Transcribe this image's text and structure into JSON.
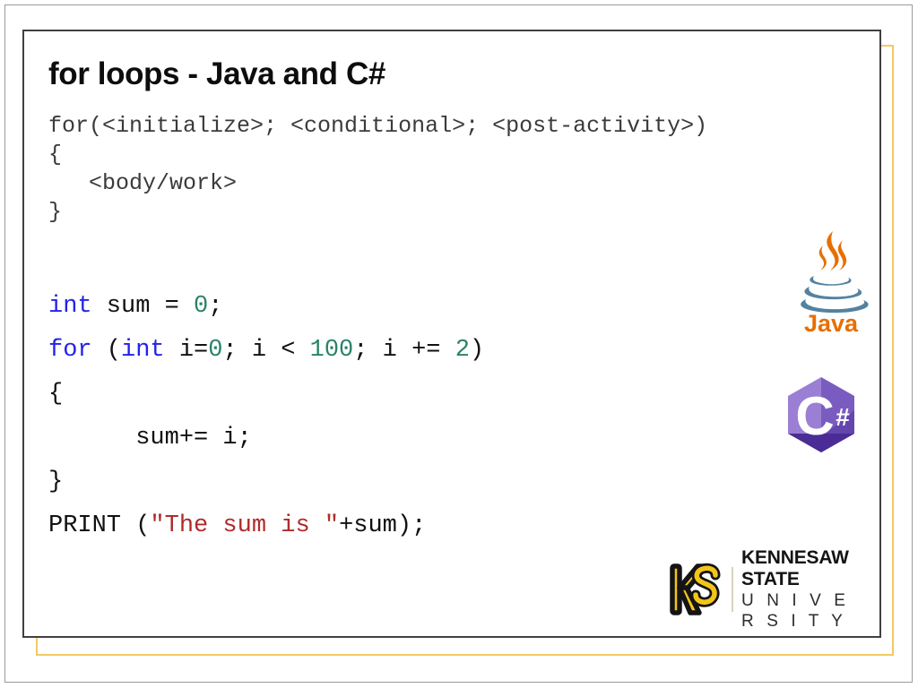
{
  "slide": {
    "title": "for loops - Java and C#",
    "background_color": "#ffffff",
    "frame_dark_color": "#404040",
    "frame_gold_color": "#f2ca63"
  },
  "code_template": {
    "lines": [
      "for(<initialize>; <conditional>; <post-activity>)",
      "{",
      "   <body/work>",
      "}"
    ],
    "color": "#3b3b3b"
  },
  "code_example": {
    "colors": {
      "keyword": "#2323e8",
      "number": "#2b8268",
      "string": "#b02b2b",
      "plain": "#111111"
    },
    "lines": [
      [
        {
          "text": "int",
          "type": "keyword"
        },
        {
          "text": " sum = ",
          "type": "plain"
        },
        {
          "text": "0",
          "type": "number"
        },
        {
          "text": ";",
          "type": "plain"
        }
      ],
      [
        {
          "text": "for",
          "type": "keyword"
        },
        {
          "text": " (",
          "type": "plain"
        },
        {
          "text": "int",
          "type": "keyword"
        },
        {
          "text": " i=",
          "type": "plain"
        },
        {
          "text": "0",
          "type": "number"
        },
        {
          "text": "; i < ",
          "type": "plain"
        },
        {
          "text": "100",
          "type": "number"
        },
        {
          "text": "; i += ",
          "type": "plain"
        },
        {
          "text": "2",
          "type": "number"
        },
        {
          "text": ")",
          "type": "plain"
        }
      ],
      [
        {
          "text": "{",
          "type": "plain"
        }
      ],
      [
        {
          "text": "      sum+= i;",
          "type": "plain"
        }
      ],
      [
        {
          "text": "}",
          "type": "plain"
        }
      ],
      [
        {
          "text": "PRINT (",
          "type": "plain"
        },
        {
          "text": "\"The sum is \"",
          "type": "string"
        },
        {
          "text": "+sum);",
          "type": "plain"
        }
      ]
    ]
  },
  "logos": {
    "java": {
      "name": "java-logo",
      "wordmark": "Java",
      "steam_color": "#e76f00",
      "cup_color": "#5382a1",
      "wordmark_color": "#e76f00"
    },
    "csharp": {
      "name": "csharp-logo",
      "letter": "C",
      "sharp": "#",
      "hex_light": "#9b7fd4",
      "hex_mid": "#7a5cc0",
      "hex_dark": "#4b2d96",
      "glyph_color": "#ffffff"
    },
    "ksu": {
      "name": "kennesaw-state-university-logo",
      "line1": "KENNESAW STATE",
      "line2": "U N I V E R S I T Y",
      "gold_color": "#f4c518",
      "black_color": "#141414"
    }
  }
}
